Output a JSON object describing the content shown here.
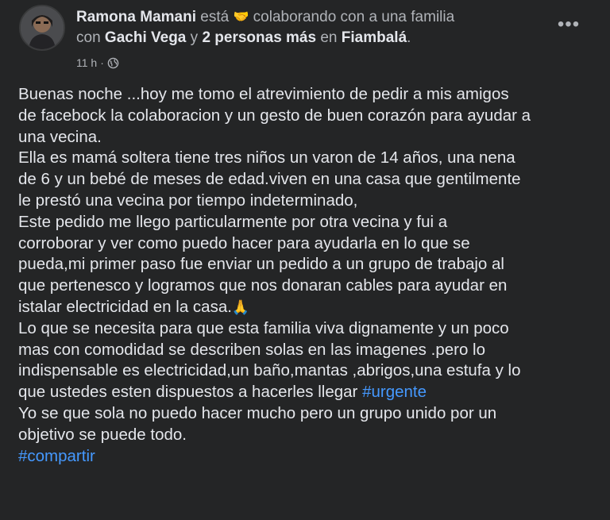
{
  "post": {
    "author": "Ramona Mamani",
    "verb": "está",
    "activity_emoji": "🤝",
    "activity": "colaborando con a una familia",
    "with_word": "con",
    "tagged": "Gachi Vega",
    "and_word": "y",
    "others": "2 personas más",
    "in_word": "en",
    "location": "Fiambalá",
    "location_suffix": ".",
    "time": "11 h",
    "separator": "·",
    "privacy_icon": "globe-icon",
    "more_icon": "more-options-icon",
    "more_label": "•••",
    "lines": [
      "Buenas noche ...hoy me tomo el atrevimiento de pedir a mis amigos",
      "de facebock la colaboracion y un gesto de buen corazón para ayudar a",
      "una vecina.",
      "Ella es mamá soltera tiene tres niños un varon de 14 años, una nena",
      "de 6 y un bebé de meses de edad.viven en una casa que gentilmente",
      "le prestó una vecina por tiempo indeterminado,",
      "Este pedido me llego particularmente por otra vecina y fui a",
      "corroborar y ver como puedo hacer para ayudarla en lo que se",
      "pueda,mi primer paso fue enviar un pedido a un grupo de trabajo al",
      "que pertenesco y logramos que nos donaran cables para ayudar en",
      "istalar electricidad en la casa.",
      "Lo que se necesita para que esta familia viva dignamente y un poco",
      "mas con comodidad se describen solas en las imagenes .pero lo",
      "indispensable es electricidad,un baño,mantas ,abrigos,una estufa y lo",
      "que ustedes esten dispuestos a hacerles llegar",
      "Yo se que sola no puedo hacer mucho pero un grupo unido por un",
      "objetivo se puede todo."
    ],
    "pray_emoji": "🙏",
    "hashtag_urgente": "#urgente",
    "hashtag_compartir": "#compartir"
  },
  "colors": {
    "background": "#242526",
    "text_primary": "#e4e6eb",
    "text_secondary": "#b0b3b8",
    "link": "#4599ff"
  }
}
